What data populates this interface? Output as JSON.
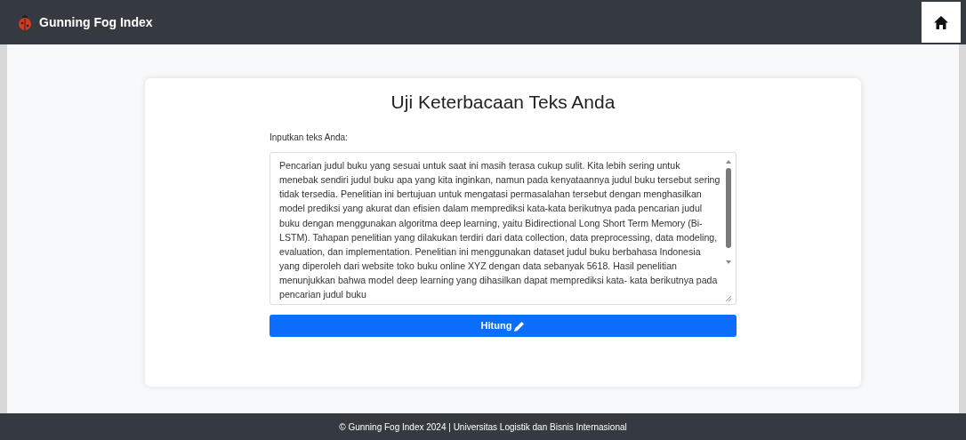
{
  "navbar": {
    "brand": "Gunning Fog Index"
  },
  "form": {
    "title": "Uji Keterbacaan Teks Anda",
    "label": "Inputkan teks Anda:",
    "text": "Pencarian judul buku yang sesuai untuk saat ini masih terasa cukup sulit. Kita lebih sering untuk menebak sendiri judul buku apa yang kita inginkan, namun pada kenyataannya judul buku tersebut sering tidak tersedia. Penelitian ini bertujuan untuk mengatasi permasalahan tersebut dengan menghasilkan model prediksi yang akurat dan efisien dalam memprediksi kata-kata berikutnya pada pencarian judul buku dengan menggunakan algoritma deep learning, yaitu Bidirectional Long Short Term Memory (Bi-LSTM). Tahapan penelitian yang dilakukan terdiri dari data collection, data preprocessing, data modeling, evaluation, dan implementation. Penelitian ini menggunakan dataset judul buku berbahasa Indonesia yang diperoleh dari website toko buku online XYZ dengan data sebanyak 5618. Hasil penelitian menunjukkan bahwa model deep learning yang dihasilkan dapat memprediksi kata- kata berikutnya pada pencarian judul buku",
    "button": "Hitung"
  },
  "footer": "© Gunning Fog Index 2024 | Universitas Logistik dan Bisnis Internasional"
}
